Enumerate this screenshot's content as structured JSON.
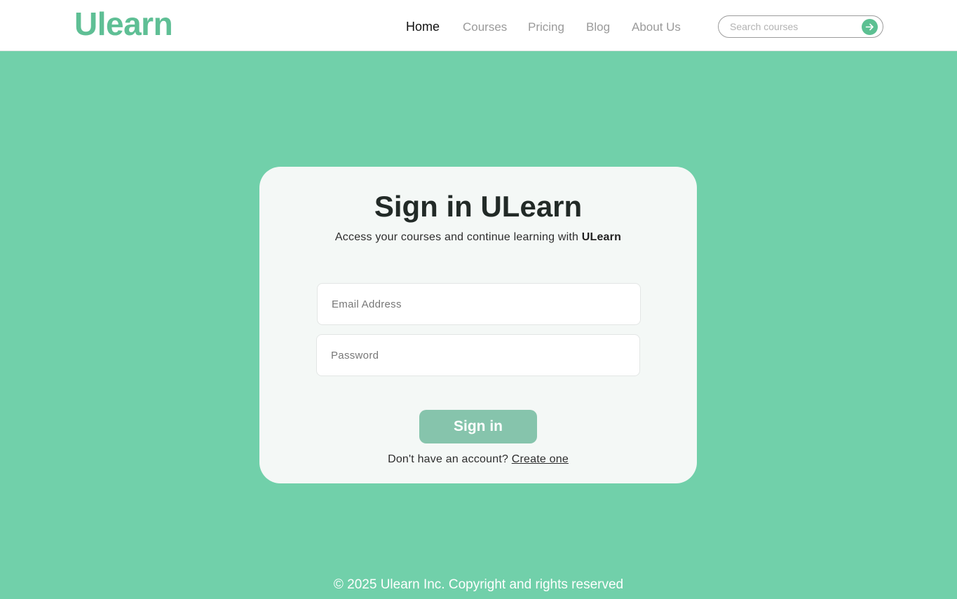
{
  "brand": {
    "logo": "Ulearn",
    "accent_color": "#5fbf95"
  },
  "nav": {
    "items": [
      {
        "label": "Home",
        "active": true
      },
      {
        "label": "Courses",
        "active": false
      },
      {
        "label": "Pricing",
        "active": false
      },
      {
        "label": "Blog",
        "active": false
      },
      {
        "label": "About Us",
        "active": false
      }
    ]
  },
  "search": {
    "placeholder": "Search courses",
    "value": "",
    "button_icon": "arrow-right-icon"
  },
  "signin": {
    "title": "Sign in ULearn",
    "subtitle_prefix": "Access your courses and continue learning with ",
    "subtitle_brand": "ULearn",
    "email": {
      "placeholder": "Email Address",
      "value": ""
    },
    "password": {
      "placeholder": "Password",
      "value": ""
    },
    "submit_label": "Sign in",
    "no_account_text": "Don't have an account? ",
    "create_link": "Create one"
  },
  "footer": {
    "copyright": "© 2025 Ulearn Inc. Copyright and rights reserved"
  },
  "colors": {
    "page_background": "#71d0aa",
    "card_background": "#f4f8f6",
    "button_background": "#86c4ac"
  }
}
